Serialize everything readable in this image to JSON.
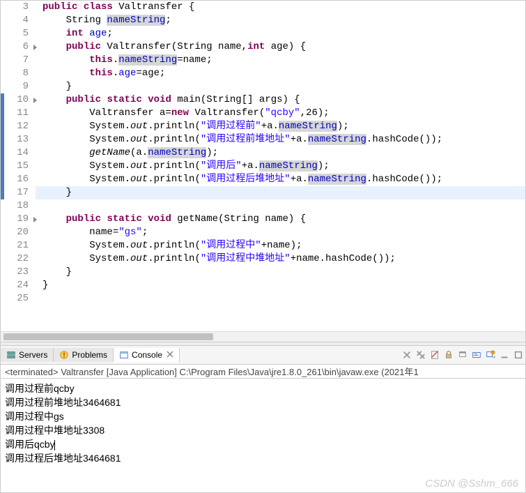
{
  "code": {
    "lines": [
      {
        "n": 3,
        "fold": false,
        "bar": false,
        "hl": false,
        "html": "<span class='kw'>public</span> <span class='kw'>class</span> Valtransfer {"
      },
      {
        "n": 4,
        "fold": false,
        "bar": false,
        "hl": false,
        "html": "    String <span class='fld fld-bg'>nameString</span>;"
      },
      {
        "n": 5,
        "fold": false,
        "bar": false,
        "hl": false,
        "html": "    <span class='kw'>int</span> <span class='fld'>age</span>;"
      },
      {
        "n": 6,
        "fold": true,
        "bar": false,
        "hl": false,
        "html": "    <span class='kw'>public</span> Valtransfer(String name,<span class='kw'>int</span> age) {"
      },
      {
        "n": 7,
        "fold": false,
        "bar": false,
        "hl": false,
        "html": "        <span class='kw'>this</span>.<span class='fld fld-bg'>nameString</span>=name;"
      },
      {
        "n": 8,
        "fold": false,
        "bar": false,
        "hl": false,
        "html": "        <span class='kw'>this</span>.<span class='fld'>age</span>=age;"
      },
      {
        "n": 9,
        "fold": false,
        "bar": false,
        "hl": false,
        "html": "    }"
      },
      {
        "n": 10,
        "fold": true,
        "bar": true,
        "hl": false,
        "html": "    <span class='kw'>public</span> <span class='kw'>static</span> <span class='kw'>void</span> main(String[] args) {"
      },
      {
        "n": 11,
        "fold": false,
        "bar": true,
        "hl": false,
        "html": "        Valtransfer a=<span class='kw'>new</span> Valtransfer(<span class='str'>\"qcby\"</span>,26);"
      },
      {
        "n": 12,
        "fold": false,
        "bar": true,
        "hl": false,
        "html": "        System.<span class='fld sta'>out</span>.println(<span class='str'>\"调用过程前\"</span>+a.<span class='fld fld-bg'>nameString</span>);"
      },
      {
        "n": 13,
        "fold": false,
        "bar": true,
        "hl": false,
        "html": "        System.<span class='fld sta'>out</span>.println(<span class='str'>\"调用过程前堆地址\"</span>+a.<span class='fld fld-bg'>nameString</span>.hashCode());"
      },
      {
        "n": 14,
        "fold": false,
        "bar": true,
        "hl": false,
        "html": "        <span class='mth'>getName</span>(a.<span class='fld fld-bg'>nameString</span>);"
      },
      {
        "n": 15,
        "fold": false,
        "bar": true,
        "hl": false,
        "html": "        System.<span class='fld sta'>out</span>.println(<span class='str'>\"调用后\"</span>+a.<span class='fld fld-bg'>nameString</span>);"
      },
      {
        "n": 16,
        "fold": false,
        "bar": true,
        "hl": false,
        "html": "        System.<span class='fld sta'>out</span>.println(<span class='str'>\"调用过程后堆地址\"</span>+a.<span class='fld fld-bg'>nameString</span>.hashCode());"
      },
      {
        "n": 17,
        "fold": false,
        "bar": true,
        "hl": true,
        "html": "    }"
      },
      {
        "n": 18,
        "fold": false,
        "bar": false,
        "hl": false,
        "html": ""
      },
      {
        "n": 19,
        "fold": true,
        "bar": false,
        "hl": false,
        "html": "    <span class='kw'>public</span> <span class='kw'>static</span> <span class='kw'>void</span> getName(String name) {"
      },
      {
        "n": 20,
        "fold": false,
        "bar": false,
        "hl": false,
        "html": "        name=<span class='str'>\"gs\"</span>;"
      },
      {
        "n": 21,
        "fold": false,
        "bar": false,
        "hl": false,
        "html": "        System.<span class='fld sta'>out</span>.println(<span class='str'>\"调用过程中\"</span>+name);"
      },
      {
        "n": 22,
        "fold": false,
        "bar": false,
        "hl": false,
        "html": "        System.<span class='fld sta'>out</span>.println(<span class='str'>\"调用过程中堆地址\"</span>+name.hashCode());"
      },
      {
        "n": 23,
        "fold": false,
        "bar": false,
        "hl": false,
        "html": "    }"
      },
      {
        "n": 24,
        "fold": false,
        "bar": false,
        "hl": false,
        "html": "}"
      },
      {
        "n": 25,
        "fold": false,
        "bar": false,
        "hl": false,
        "html": ""
      }
    ]
  },
  "tabs": {
    "servers": "Servers",
    "problems": "Problems",
    "console": "Console"
  },
  "term_line": "<terminated> Valtransfer [Java Application] C:\\Program Files\\Java\\jre1.8.0_261\\bin\\javaw.exe (2021年1",
  "console_output": [
    "调用过程前qcby",
    "调用过程前堆地址3464681",
    "调用过程中gs",
    "调用过程中堆地址3308",
    "调用后qcby",
    "调用过程后堆地址3464681"
  ],
  "watermark": "CSDN @Sshm_666"
}
